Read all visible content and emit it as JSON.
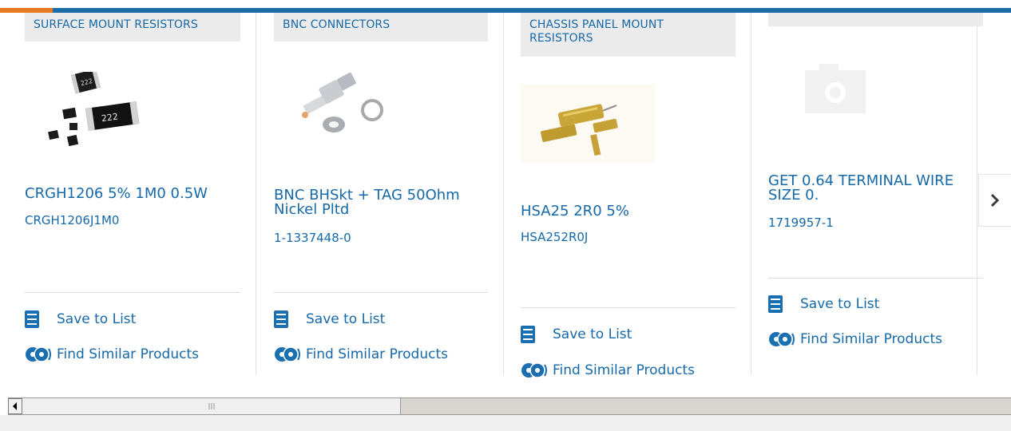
{
  "colors": {
    "brand_blue": "#1669a8",
    "accent_orange": "#e8791e",
    "bar_blue": "#1d6ea8"
  },
  "cards": [
    {
      "category": "SURFACE MOUNT RESISTORS",
      "title": "CRGH1206 5% 1M0 0.5W",
      "sku": "CRGH1206J1M0",
      "save_label": "Save to List",
      "similar_label": "Find Similar Products"
    },
    {
      "category": "BNC CONNECTORS",
      "title": "BNC BHSkt + TAG 50Ohm Nickel Pltd",
      "sku": "1-1337448-0",
      "save_label": "Save to List",
      "similar_label": "Find Similar Products"
    },
    {
      "category": "CHASSIS PANEL MOUNT RESISTORS",
      "title": "HSA25 2R0 5%",
      "sku": "HSA252R0J",
      "save_label": "Save to List",
      "similar_label": "Find Similar Products"
    },
    {
      "category": "",
      "title": "GET 0.64 TERMINAL WIRE SIZE 0.",
      "sku": "1719957-1",
      "save_label": "Save to List",
      "similar_label": "Find Similar Products"
    }
  ],
  "icons": {
    "next": "chevron-right-icon",
    "save": "checklist-icon",
    "similar": "find-similar-icon",
    "placeholder": "camera-placeholder-icon"
  }
}
